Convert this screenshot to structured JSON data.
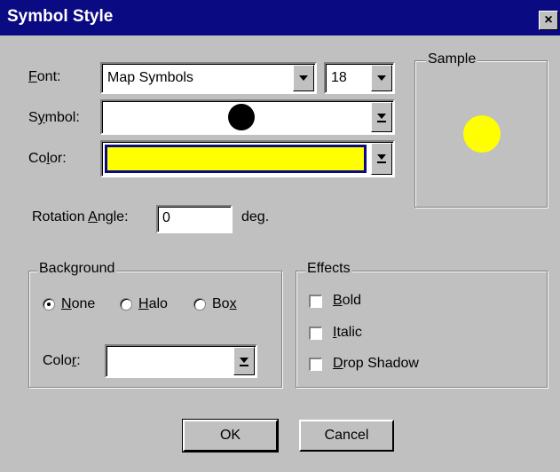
{
  "window": {
    "title": "Symbol Style",
    "close_label": "×"
  },
  "font": {
    "label_prefix": "",
    "label_key": "F",
    "label_rest": "ont:",
    "value": "Map Symbols",
    "size": "18"
  },
  "symbol": {
    "label": "Symbol:",
    "glyph": "●"
  },
  "color": {
    "label": "Color:",
    "value_color": "#ffff00"
  },
  "sample": {
    "title": "Sample",
    "dot_color": "#ffff00"
  },
  "rotation": {
    "label_pre": "Rotation ",
    "label_key": "A",
    "label_rest": "ngle:",
    "value": "0",
    "unit": "deg."
  },
  "background": {
    "title": "Background",
    "options": [
      {
        "key": "N",
        "rest": "one",
        "selected": true
      },
      {
        "key": "H",
        "rest": "alo",
        "selected": false
      },
      {
        "pre": "Bo",
        "key": "x",
        "rest": "",
        "selected": false
      }
    ],
    "color_label": "Color:",
    "color_value": ""
  },
  "effects": {
    "title": "Effects",
    "items": [
      {
        "key": "B",
        "rest": "old",
        "checked": false
      },
      {
        "key": "I",
        "rest": "talic",
        "checked": false
      },
      {
        "key": "D",
        "rest": "rop Shadow",
        "checked": false
      }
    ]
  },
  "buttons": {
    "ok": "OK",
    "cancel": "Cancel"
  }
}
